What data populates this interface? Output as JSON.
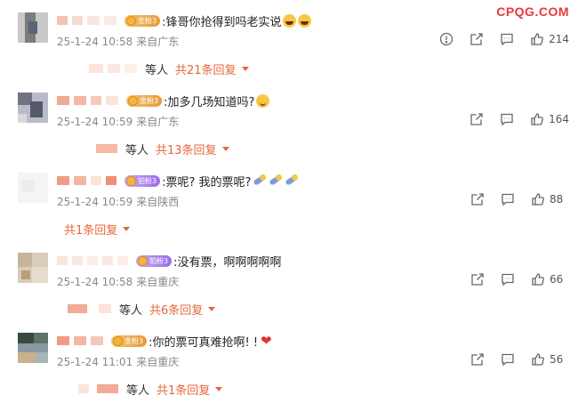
{
  "watermark": "CPQG.COM",
  "comments": [
    {
      "badge": "金粉3",
      "text": ":锋哥你抢得到吗老实说",
      "date": "25-1-24 10:58",
      "location": "来自广东",
      "likes": "214",
      "reply_etc": "等人",
      "reply_count": "共21条回复"
    },
    {
      "badge": "金粉3",
      "text": ":加多几场知道吗?",
      "date": "25-1-24 10:59",
      "location": "来自广东",
      "likes": "164",
      "reply_etc": "等人",
      "reply_count": "共13条回复"
    },
    {
      "badge": "铂粉3",
      "text": ":票呢? 我的票呢?",
      "date": "25-1-24 10:59",
      "location": "来自陕西",
      "likes": "88",
      "reply_count": "共1条回复"
    },
    {
      "badge": "铂粉3",
      "text": ":没有票，啊啊啊啊啊",
      "date": "25-1-24 10:58",
      "location": "来自重庆",
      "likes": "66",
      "reply_etc": "等人",
      "reply_count": "共6条回复"
    },
    {
      "badge": "金粉3",
      "text": ":你的票可真难抢啊! !",
      "date": "25-1-24 11:01",
      "location": "来自重庆",
      "likes": "56",
      "reply_etc": "等人",
      "reply_count": "共1条回复"
    }
  ],
  "icons": {
    "report": "report-icon",
    "repost": "repost-icon",
    "comment": "comment-icon",
    "like": "thumbs-up-icon",
    "expand": "caret-down-icon"
  },
  "colors": {
    "watermark": "#e8383d",
    "reply_link": "#e8673a",
    "meta_text": "#888888",
    "gold_badge": "#e79a3a",
    "diamond_badge": "#9a6de8"
  }
}
